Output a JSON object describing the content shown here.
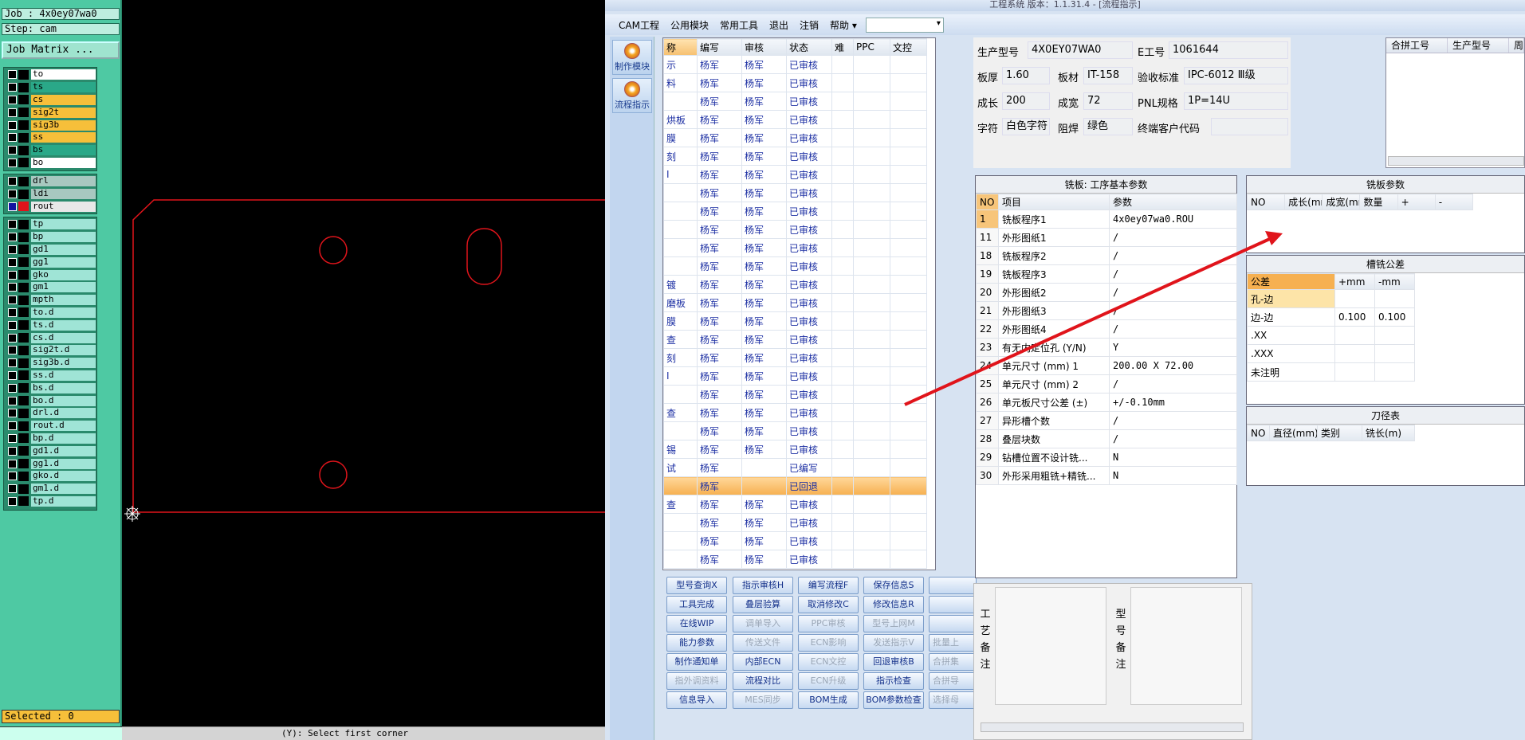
{
  "genesis": {
    "job_label": "Job : 4x0ey07wa0",
    "step_label": "Step: cam",
    "job_matrix_button": "Job Matrix ...",
    "layers_group1": [
      {
        "name": "to",
        "color": "#ffffff"
      },
      {
        "name": "ts",
        "color": "#2aa888"
      },
      {
        "name": "cs",
        "color": "#f6bf3a"
      },
      {
        "name": "sig2t",
        "color": "#f6bf3a"
      },
      {
        "name": "sig3b",
        "color": "#f6bf3a"
      },
      {
        "name": "ss",
        "color": "#f6bf3a"
      },
      {
        "name": "bs",
        "color": "#2aa888"
      },
      {
        "name": "bo",
        "color": "#ffffff"
      }
    ],
    "layers_group2": [
      {
        "name": "drl",
        "color": "#a8c8c0"
      },
      {
        "name": "ldi",
        "color": "#a8c8c0"
      },
      {
        "name": "rout",
        "color": "#e8e8e8"
      }
    ],
    "layers_group3": [
      {
        "name": "tp",
        "color": "#9fe4d6"
      },
      {
        "name": "bp",
        "color": "#9fe4d6"
      },
      {
        "name": "gd1",
        "color": "#9fe4d6"
      },
      {
        "name": "gg1",
        "color": "#9fe4d6"
      },
      {
        "name": "gko",
        "color": "#9fe4d6"
      },
      {
        "name": "gm1",
        "color": "#9fe4d6"
      },
      {
        "name": "mpth",
        "color": "#9fe4d6"
      },
      {
        "name": "to.d",
        "color": "#9fe4d6"
      },
      {
        "name": "ts.d",
        "color": "#9fe4d6"
      },
      {
        "name": "cs.d",
        "color": "#9fe4d6"
      },
      {
        "name": "sig2t.d",
        "color": "#9fe4d6"
      },
      {
        "name": "sig3b.d",
        "color": "#9fe4d6"
      },
      {
        "name": "ss.d",
        "color": "#9fe4d6"
      },
      {
        "name": "bs.d",
        "color": "#9fe4d6"
      },
      {
        "name": "bo.d",
        "color": "#9fe4d6"
      },
      {
        "name": "drl.d",
        "color": "#9fe4d6"
      },
      {
        "name": "rout.d",
        "color": "#9fe4d6"
      },
      {
        "name": "bp.d",
        "color": "#9fe4d6"
      },
      {
        "name": "gd1.d",
        "color": "#9fe4d6"
      },
      {
        "name": "gg1.d",
        "color": "#9fe4d6"
      },
      {
        "name": "gko.d",
        "color": "#9fe4d6"
      },
      {
        "name": "gm1.d",
        "color": "#9fe4d6"
      },
      {
        "name": "tp.d",
        "color": "#9fe4d6"
      }
    ],
    "selected_label": "Selected : 0",
    "status_prompt": "(Y): Select first corner"
  },
  "app": {
    "title": "工程系统  版本：1.1.31.4 - [流程指示]",
    "menu": [
      "CAM工程",
      "公用模块",
      "常用工具",
      "退出",
      "注销",
      "帮助 ▾"
    ],
    "nav": [
      {
        "label": "制作模块"
      },
      {
        "label": "流程指示"
      }
    ],
    "flow_headers": [
      "称",
      "编写",
      "审核",
      "状态",
      "难",
      "PPC",
      "文控"
    ],
    "flow_rows": [
      [
        "示",
        "杨军",
        "杨军",
        "已审核"
      ],
      [
        "料",
        "杨军",
        "杨军",
        "已审核"
      ],
      [
        "",
        "杨军",
        "杨军",
        "已审核"
      ],
      [
        "烘板",
        "杨军",
        "杨军",
        "已审核"
      ],
      [
        "膜",
        "杨军",
        "杨军",
        "已审核"
      ],
      [
        "刻",
        "杨军",
        "杨军",
        "已审核"
      ],
      [
        "I",
        "杨军",
        "杨军",
        "已审核"
      ],
      [
        "",
        "杨军",
        "杨军",
        "已审核"
      ],
      [
        "",
        "杨军",
        "杨军",
        "已审核"
      ],
      [
        "",
        "杨军",
        "杨军",
        "已审核"
      ],
      [
        "",
        "杨军",
        "杨军",
        "已审核"
      ],
      [
        "",
        "杨军",
        "杨军",
        "已审核"
      ],
      [
        "镀",
        "杨军",
        "杨军",
        "已审核"
      ],
      [
        "磨板",
        "杨军",
        "杨军",
        "已审核"
      ],
      [
        "膜",
        "杨军",
        "杨军",
        "已审核"
      ],
      [
        "查",
        "杨军",
        "杨军",
        "已审核"
      ],
      [
        "刻",
        "杨军",
        "杨军",
        "已审核"
      ],
      [
        "I",
        "杨军",
        "杨军",
        "已审核"
      ],
      [
        "",
        "杨军",
        "杨军",
        "已审核"
      ],
      [
        "查",
        "杨军",
        "杨军",
        "已审核"
      ],
      [
        "",
        "杨军",
        "杨军",
        "已审核"
      ],
      [
        "锡",
        "杨军",
        "杨军",
        "已审核"
      ],
      [
        "试",
        "杨军",
        "",
        "已编写"
      ],
      [
        "",
        "杨军",
        "",
        "已回退"
      ],
      [
        "查",
        "杨军",
        "杨军",
        "已审核"
      ],
      [
        "",
        "杨军",
        "杨军",
        "已审核"
      ],
      [
        "",
        "杨军",
        "杨军",
        "已审核"
      ],
      [
        "",
        "杨军",
        "杨军",
        "已审核"
      ]
    ],
    "highlight_row": 23,
    "buttons": [
      [
        "型号查询X",
        "指示审核H",
        "编写流程F",
        "保存信息S",
        ""
      ],
      [
        "工具完成",
        "叠层验算",
        "取消修改C",
        "修改信息R",
        ""
      ],
      [
        "在线WIP",
        "调单导入",
        "PPC审核",
        "型号上网M",
        ""
      ],
      [
        "能力参数",
        "传送文件",
        "ECN影响",
        "发送指示V",
        "批量上"
      ],
      [
        "制作通知单",
        "内部ECN",
        "ECN文控",
        "回退审核B",
        "合拼集"
      ],
      [
        "指外调资料",
        "流程对比",
        "ECN升级",
        "指示检查",
        "合拼导"
      ],
      [
        "信息导入",
        "MES同步",
        "BOM生成",
        "BOM参数检查",
        "选择母"
      ]
    ],
    "buttons_disabled": [
      [
        false,
        false,
        false,
        false,
        false
      ],
      [
        false,
        false,
        false,
        false,
        false
      ],
      [
        false,
        true,
        true,
        true,
        false
      ],
      [
        false,
        true,
        true,
        true,
        true
      ],
      [
        false,
        false,
        true,
        false,
        true
      ],
      [
        true,
        false,
        true,
        false,
        true
      ],
      [
        false,
        true,
        false,
        false,
        true
      ]
    ],
    "info": {
      "model_label": "生产型号",
      "model_value": "4X0EY07WA0",
      "eno_label": "E工号",
      "eno_value": "1061644",
      "thick_label": "板厚",
      "thick_value": "1.60",
      "mat_label": "板材",
      "mat_value": "IT-158",
      "std_label": "验收标准",
      "std_value": "IPC-6012 Ⅲ级",
      "len_label": "成长",
      "len_value": "200",
      "wid_label": "成宽",
      "wid_value": "72",
      "pnl_label": "PNL规格",
      "pnl_value": "1P=14U",
      "char_label": "字符",
      "char_value": "白色字符",
      "mask_label": "阻焊",
      "mask_value": "绿色",
      "cust_label": "终端客户代码",
      "cust_value": ""
    },
    "merge_headers": [
      "合拼工号",
      "生产型号",
      "周"
    ],
    "params_title": "铣板: 工序基本参数",
    "params_headers": [
      "NO",
      "项目",
      "参数"
    ],
    "params_rows": [
      [
        "1",
        "铣板程序1",
        "4x0ey07wa0.ROU"
      ],
      [
        "11",
        "外形图纸1",
        "/"
      ],
      [
        "18",
        "铣板程序2",
        "/"
      ],
      [
        "19",
        "铣板程序3",
        "/"
      ],
      [
        "20",
        "外形图纸2",
        "/"
      ],
      [
        "21",
        "外形图纸3",
        "/"
      ],
      [
        "22",
        "外形图纸4",
        "/"
      ],
      [
        "23",
        "有无内定位孔 (Y/N)",
        "Y"
      ],
      [
        "24",
        "单元尺寸 (mm) 1",
        "200.00 X 72.00"
      ],
      [
        "25",
        "单元尺寸 (mm) 2",
        "/"
      ],
      [
        "26",
        "单元板尺寸公差 (±)",
        "+/-0.10mm"
      ],
      [
        "27",
        "异形槽个数",
        "/"
      ],
      [
        "28",
        "叠层块数",
        "/"
      ],
      [
        "29",
        "钻槽位置不设计铣...",
        "N"
      ],
      [
        "30",
        "外形采用粗铣+精铣...",
        "N"
      ]
    ],
    "mill_title": "铣板参数",
    "mill_headers": [
      "NO",
      "成长(mm)",
      "成宽(mm)",
      "数量",
      "+",
      "-"
    ],
    "tol_title": "槽铣公差",
    "tol_headers": [
      "公差",
      "+mm",
      "-mm"
    ],
    "tol_rows": [
      [
        "孔-边",
        "",
        ""
      ],
      [
        "边-边",
        "0.100",
        "0.100"
      ],
      [
        ".XX",
        "",
        ""
      ],
      [
        ".XXX",
        "",
        ""
      ],
      [
        "未注明",
        "",
        ""
      ]
    ],
    "tool_title": "刀径表",
    "tool_headers": [
      "NO",
      "直径(mm)",
      "类别",
      "铣长(m)"
    ],
    "remark1_label": "工艺备注",
    "remark2_label": "型号备注",
    "colors": {
      "accent_orange": "#f6b050",
      "arrow_red": "#e0141b",
      "board_outline": "#e0141b"
    }
  }
}
